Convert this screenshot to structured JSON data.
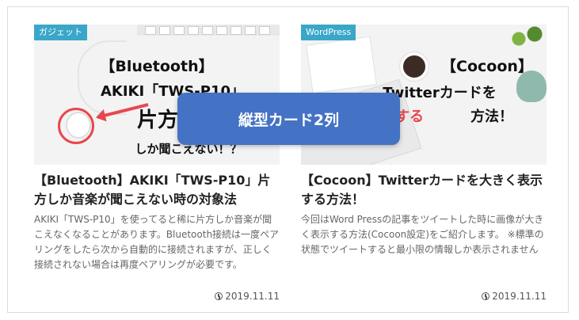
{
  "overlay": {
    "label": "縦型カード2列"
  },
  "cards": [
    {
      "category": "ガジェット",
      "thumb_lines": [
        "【Bluetooth】",
        "AKIKI「TWS-P10」",
        "片方し",
        "しか聞こえない！？"
      ],
      "title": "【Bluetooth】AKIKI「TWS-P10」片方しか音楽が聞こえない時の対象法",
      "snippet": "AKIKI「TWS-P10」を使ってると稀に片方しか音楽が聞こえなくなることがあります。Bluetooth接続は一度ペアリングをしたら次から自動的に接続されますが、正しく接続されない場合は再度ペアリングが必要です。",
      "date": "2019.11.11",
      "clock_icon": "clock-icon"
    },
    {
      "category": "WordPress",
      "thumb_lines": [
        "【Cocoon】",
        "Twitterカードを",
        "く表示する",
        "方法！"
      ],
      "title": "【Cocoon】Twitterカードを大きく表示する方法！",
      "snippet": "今回はWord Pressの記事をツイートした時に画像が大きく表示する方法(Cocoon設定)をご紹介します。 ※標準の状態でツイートすると最小限の情報しか表示されません",
      "date": "2019.11.11",
      "clock_icon": "clock-icon"
    }
  ],
  "colors": {
    "accent": "#4472c4",
    "category_bg": "#3aa7c9",
    "highlight": "#e8474e"
  }
}
